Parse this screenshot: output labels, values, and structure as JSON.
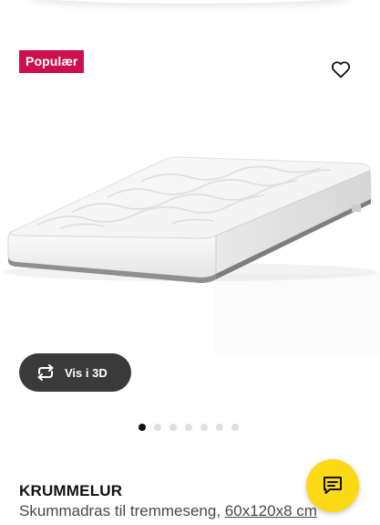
{
  "badge": {
    "label": "Populær"
  },
  "view_3d": {
    "label": "Vis i 3D"
  },
  "carousel": {
    "count": 7,
    "active_index": 0
  },
  "product": {
    "name": "KRUMMELUR",
    "description": "Skummadras til tremmeseng, ",
    "size": "60x120x8 cm"
  },
  "colors": {
    "badge": "#cc0f4f",
    "chat_button": "#fbd914",
    "button_dark": "#3a3a3a"
  },
  "icons": {
    "favorite": "heart-outline-icon",
    "view_3d": "rotate-3d-icon",
    "chat": "chat-bubble-icon"
  }
}
